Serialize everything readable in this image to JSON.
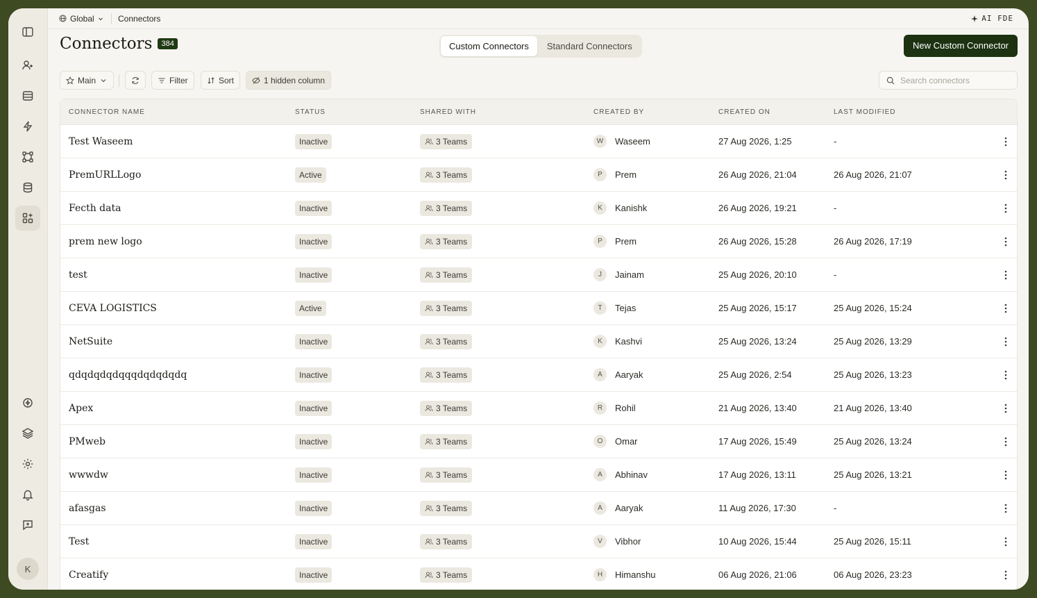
{
  "topbar": {
    "workspace": "Global",
    "current": "Connectors",
    "ai_label": "AI FDE"
  },
  "header": {
    "title": "Connectors",
    "count": "384",
    "new_button": "New Custom Connector"
  },
  "tabs": [
    {
      "label": "Custom Connectors",
      "active": true
    },
    {
      "label": "Standard Connectors",
      "active": false
    }
  ],
  "toolbar": {
    "view": "Main",
    "filter": "Filter",
    "sort": "Sort",
    "hidden": "1 hidden column"
  },
  "search": {
    "placeholder": "Search connectors",
    "value": ""
  },
  "columns": [
    "CONNECTOR NAME",
    "STATUS",
    "SHARED WITH",
    "CREATED BY",
    "CREATED ON",
    "LAST MODIFIED"
  ],
  "rows": [
    {
      "name": "Test Waseem",
      "status": "Inactive",
      "shared": "3 Teams",
      "initial": "W",
      "creator": "Waseem",
      "created": "27 Aug 2026, 1:25",
      "modified": "-"
    },
    {
      "name": "PremURLLogo",
      "status": "Active",
      "shared": "3 Teams",
      "initial": "P",
      "creator": "Prem",
      "created": "26 Aug 2026, 21:04",
      "modified": "26 Aug 2026, 21:07"
    },
    {
      "name": "Fecth data",
      "status": "Inactive",
      "shared": "3 Teams",
      "initial": "K",
      "creator": "Kanishk",
      "created": "26 Aug 2026, 19:21",
      "modified": "-"
    },
    {
      "name": "prem new logo",
      "status": "Inactive",
      "shared": "3 Teams",
      "initial": "P",
      "creator": "Prem",
      "created": "26 Aug 2026, 15:28",
      "modified": "26 Aug 2026, 17:19"
    },
    {
      "name": "test",
      "status": "Inactive",
      "shared": "3 Teams",
      "initial": "J",
      "creator": "Jainam",
      "created": "25 Aug 2026, 20:10",
      "modified": "-"
    },
    {
      "name": "CEVA LOGISTICS",
      "status": "Active",
      "shared": "3 Teams",
      "initial": "T",
      "creator": "Tejas",
      "created": "25 Aug 2026, 15:17",
      "modified": "25 Aug 2026, 15:24"
    },
    {
      "name": "NetSuite",
      "status": "Inactive",
      "shared": "3 Teams",
      "initial": "K",
      "creator": "Kashvi",
      "created": "25 Aug 2026, 13:24",
      "modified": "25 Aug 2026, 13:29"
    },
    {
      "name": "qdqdqdqdqqqdqdqdqdq",
      "status": "Inactive",
      "shared": "3 Teams",
      "initial": "A",
      "creator": "Aaryak",
      "created": "25 Aug 2026, 2:54",
      "modified": "25 Aug 2026, 13:23"
    },
    {
      "name": "Apex",
      "status": "Inactive",
      "shared": "3 Teams",
      "initial": "R",
      "creator": "Rohil",
      "created": "21 Aug 2026, 13:40",
      "modified": "21 Aug 2026, 13:40"
    },
    {
      "name": "PMweb",
      "status": "Inactive",
      "shared": "3 Teams",
      "initial": "O",
      "creator": "Omar",
      "created": "17 Aug 2026, 15:49",
      "modified": "25 Aug 2026, 13:24"
    },
    {
      "name": "wwwdw",
      "status": "Inactive",
      "shared": "3 Teams",
      "initial": "A",
      "creator": "Abhinav",
      "created": "17 Aug 2026, 13:11",
      "modified": "25 Aug 2026, 13:21"
    },
    {
      "name": "afasgas",
      "status": "Inactive",
      "shared": "3 Teams",
      "initial": "A",
      "creator": "Aaryak",
      "created": "11 Aug 2026, 17:30",
      "modified": "-"
    },
    {
      "name": "Test",
      "status": "Inactive",
      "shared": "3 Teams",
      "initial": "V",
      "creator": "Vibhor",
      "created": "10 Aug 2026, 15:44",
      "modified": "25 Aug 2026, 15:11"
    },
    {
      "name": "Creatify",
      "status": "Inactive",
      "shared": "3 Teams",
      "initial": "H",
      "creator": "Himanshu",
      "created": "06 Aug 2026, 21:06",
      "modified": "06 Aug 2026, 23:23"
    }
  ],
  "user_initial": "K"
}
